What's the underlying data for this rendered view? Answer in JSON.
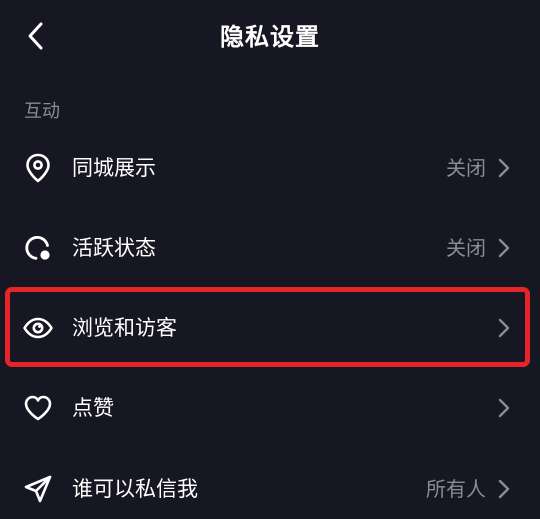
{
  "header": {
    "title": "隐私设置",
    "back_icon": "chevron-left-icon"
  },
  "section": {
    "label": "互动"
  },
  "items": [
    {
      "label": "同城展示",
      "value": "关闭",
      "icon": "location-pin-icon"
    },
    {
      "label": "活跃状态",
      "value": "关闭",
      "icon": "active-status-icon"
    },
    {
      "label": "浏览和访客",
      "value": "",
      "icon": "eye-icon"
    },
    {
      "label": "点赞",
      "value": "",
      "icon": "heart-icon"
    },
    {
      "label": "谁可以私信我",
      "value": "所有人",
      "icon": "send-icon"
    }
  ],
  "colors": {
    "background": "#161722",
    "text": "#ffffff",
    "secondary_text": "#8a8b93",
    "highlight_border": "#e5252a"
  }
}
